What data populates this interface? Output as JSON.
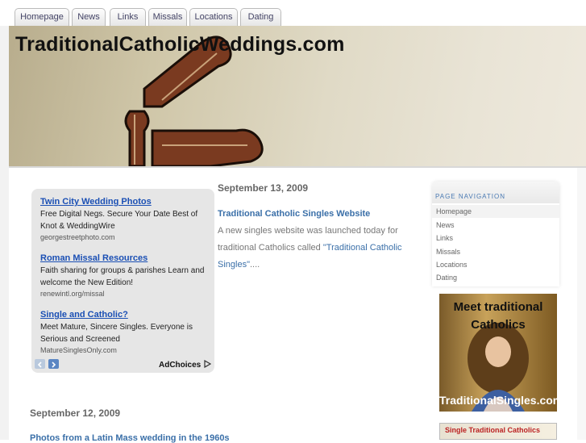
{
  "tabs": [
    "Homepage",
    "News",
    "Links",
    "Missals",
    "Locations",
    "Dating"
  ],
  "site": {
    "title": "TraditionalCatholicWeddings.com"
  },
  "ads": [
    {
      "headline": "Twin City Wedding Photos",
      "desc": "Free Digital Negs. Secure Your Date Best of Knot & WeddingWire",
      "url": "georgestreetphoto.com"
    },
    {
      "headline": "Roman Missal Resources",
      "desc": "Faith sharing for groups & parishes Learn and welcome the New Edition!",
      "url": "renewintl.org/missal"
    },
    {
      "headline": "Single and Catholic?",
      "desc": "Meet Mature, Sincere Singles. Everyone is Serious and Screened",
      "url": "MatureSinglesOnly.com"
    }
  ],
  "ad_controls": {
    "prev_icon": "arrow-left-icon",
    "next_icon": "arrow-right-icon",
    "adchoices_label": "AdChoices",
    "adchoices_icon": "play-triangle-icon"
  },
  "posts": [
    {
      "date": "September 13, 2009",
      "title": "Traditional Catholic Singles Website",
      "body_before": "A new singles website was launched today for traditional Catholics called ",
      "body_link": "\"Traditional Catholic Singles\"",
      "body_after": "...."
    },
    {
      "date": "September 12, 2009",
      "title": "Photos from a Latin Mass wedding in the 1960s"
    }
  ],
  "page_navigation": {
    "heading": "PAGE NAVIGATION",
    "items": [
      "Homepage",
      "News",
      "Links",
      "Missals",
      "Locations",
      "Dating"
    ]
  },
  "banners": {
    "b1_top": "Meet traditional Catholics",
    "b1_bottom": "TraditionalSingles.com",
    "b2": "Single Traditional Catholics"
  },
  "colors": {
    "link": "#3a6fa8",
    "ad_link": "#1a4fb4",
    "nav_heading": "#4a7ab3"
  }
}
